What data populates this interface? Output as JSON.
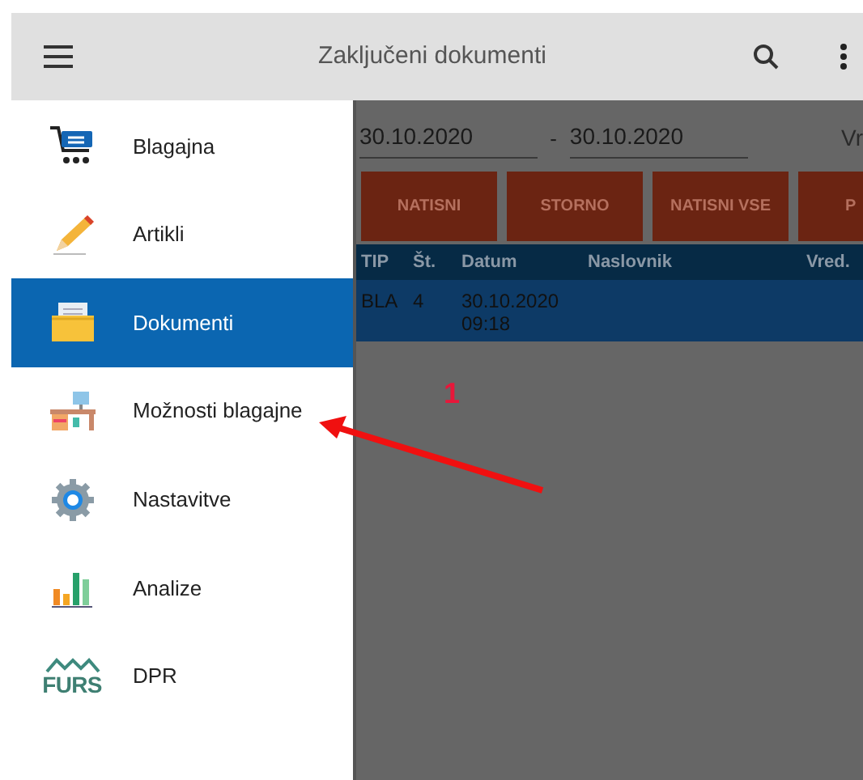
{
  "app_bar": {
    "title": "Zaključeni dokumenti"
  },
  "drawer": {
    "items": [
      {
        "label": "Blagajna",
        "kind": "cart",
        "selected": false
      },
      {
        "label": "Artikli",
        "kind": "pencil",
        "selected": false
      },
      {
        "label": "Dokumenti",
        "kind": "folder",
        "selected": true
      },
      {
        "label": "Možnosti blagajne",
        "kind": "desk",
        "selected": false
      },
      {
        "label": "Nastavitve",
        "kind": "gear",
        "selected": false
      },
      {
        "label": "Analize",
        "kind": "chart",
        "selected": false
      },
      {
        "label": "DPR",
        "kind": "furs",
        "logo_text": "FURS",
        "selected": false
      }
    ]
  },
  "filter": {
    "date_from": "30.10.2020",
    "separator": "-",
    "date_to": "30.10.2020",
    "column_3": "Vr"
  },
  "buttons": [
    "NATISNI",
    "STORNO",
    "NATISNI VSE",
    "P"
  ],
  "table": {
    "columns": [
      "TIP",
      "Št.",
      "Datum",
      "Naslovnik",
      "Vred."
    ],
    "rows": [
      {
        "cells": [
          "BLA",
          "4",
          "30.10.2020\n09:18",
          "",
          ""
        ],
        "selected": true
      }
    ]
  },
  "annotation": {
    "label": "1"
  }
}
